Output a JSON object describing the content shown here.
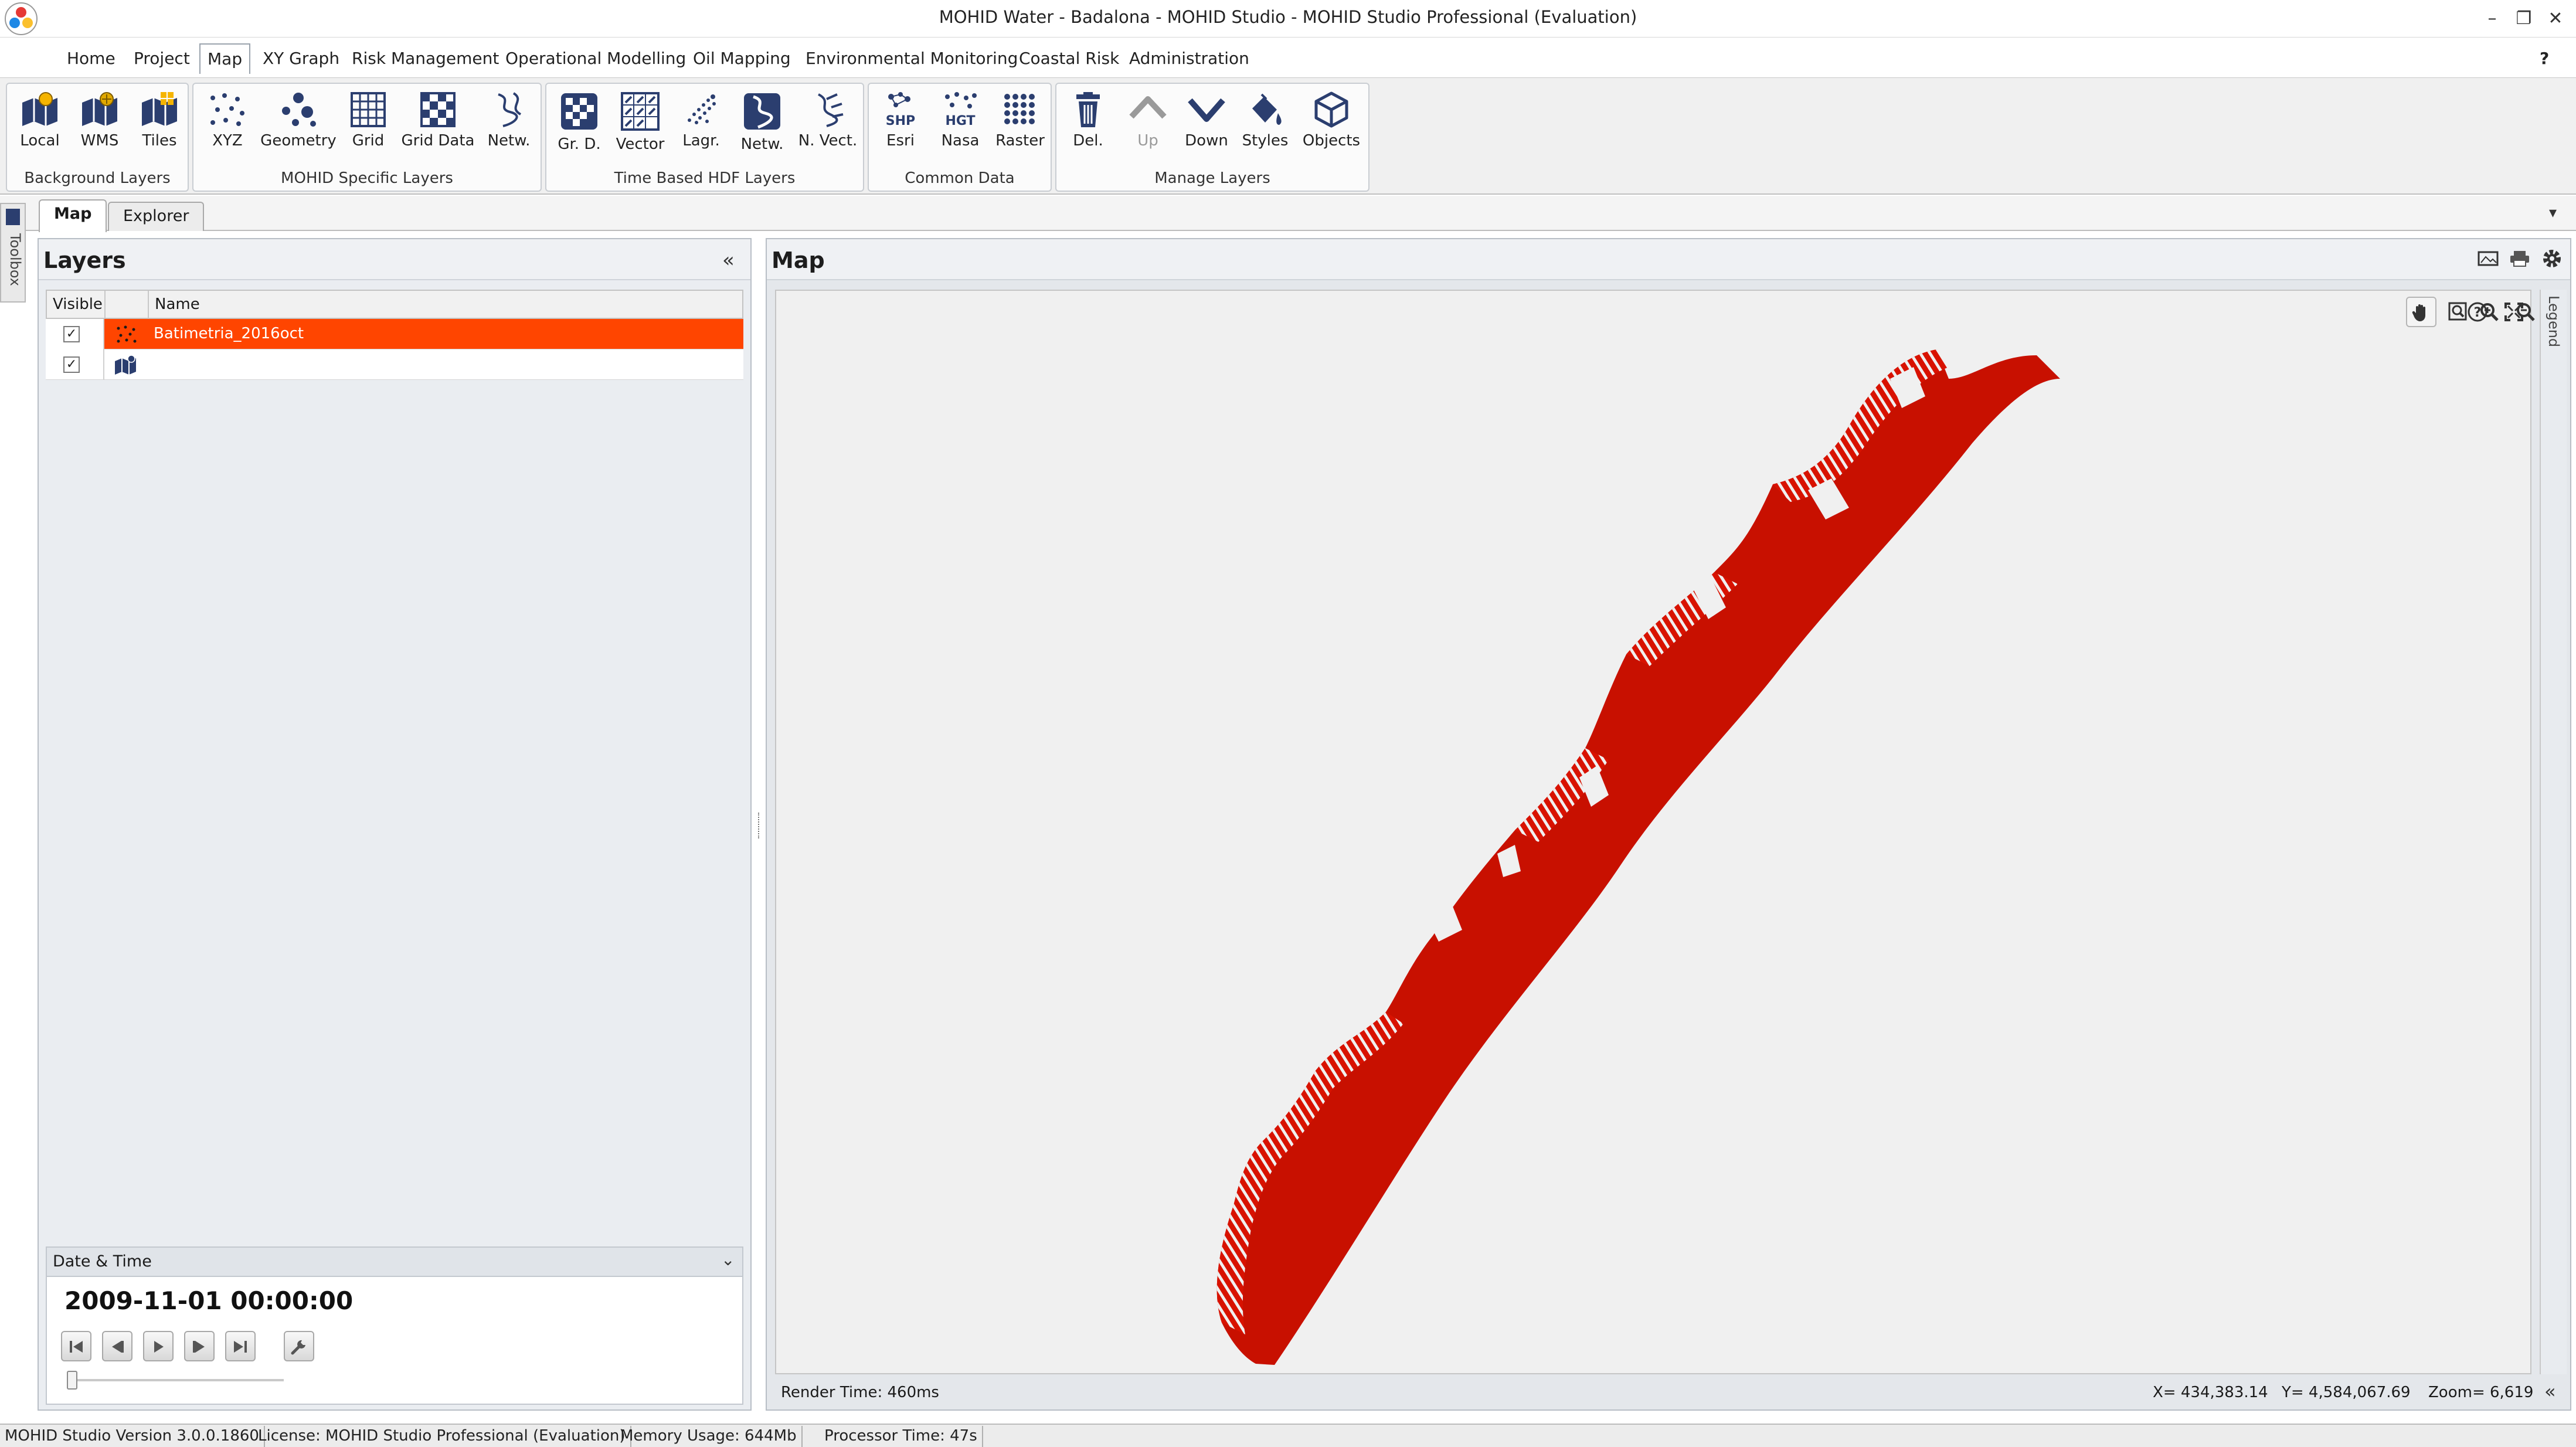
{
  "window": {
    "title": "MOHID Water - Badalona - MOHID Studio - MOHID Studio Professional (Evaluation)",
    "minimize": "–",
    "maximize": "❐",
    "close": "✕"
  },
  "menu": {
    "items": [
      "Home",
      "Project",
      "Map",
      "XY Graph",
      "Risk Management",
      "Operational Modelling",
      "Oil Mapping",
      "Environmental Monitoring",
      "Coastal Risk",
      "Administration"
    ],
    "active": "Map",
    "help": "?"
  },
  "ribbon": {
    "groups": [
      {
        "title": "Background Layers",
        "buttons": [
          "Local",
          "WMS",
          "Tiles"
        ]
      },
      {
        "title": "MOHID Specific Layers",
        "buttons": [
          "XYZ",
          "Geometry",
          "Grid",
          "Grid Data",
          "Netw."
        ]
      },
      {
        "title": "Time Based HDF Layers",
        "buttons": [
          "Gr. D.",
          "Vector",
          "Lagr.",
          "Netw.",
          "N. Vect."
        ]
      },
      {
        "title": "Common Data",
        "buttons": [
          "Esri",
          "Nasa",
          "Raster"
        ]
      },
      {
        "title": "Manage Layers",
        "buttons": [
          "Del.",
          "Up",
          "Down",
          "Styles",
          "Objects"
        ]
      }
    ],
    "icon_text": {
      "shp": "SHP",
      "hgt": "HGT"
    }
  },
  "doc_tabs": [
    "Map",
    "Explorer"
  ],
  "toolbox": {
    "label": "Toolbox"
  },
  "layers_panel": {
    "title": "Layers",
    "collapse": "«",
    "columns": [
      "Visible",
      "",
      "Name"
    ],
    "rows": [
      {
        "visible": true,
        "check": "✓",
        "name": "Batimetria_2016oct",
        "selected": true
      },
      {
        "visible": true,
        "check": "✓",
        "name": "",
        "selected": false
      }
    ]
  },
  "datetime": {
    "title": "Date & Time",
    "value": "2009-11-01 00:00:00",
    "toggle": "⌄"
  },
  "map_panel": {
    "title": "Map",
    "legend_label": "Legend",
    "render_time": "Render Time: 460ms",
    "x": "X= 434,383.14",
    "y": "Y= 4,584,067.69",
    "zoom": "Zoom= 6,619",
    "expand": "«"
  },
  "status": {
    "version": "MOHID Studio Version 3.0.0.1860",
    "license": "License: MOHID Studio Professional (Evaluation)",
    "memory": "Memory Usage: 644Mb",
    "processor": "Processor Time: 47s"
  },
  "colors": {
    "selection": "#ff4500",
    "accent_blue": "#1f3a93",
    "ribbon_bg": "#f0f0f0"
  }
}
